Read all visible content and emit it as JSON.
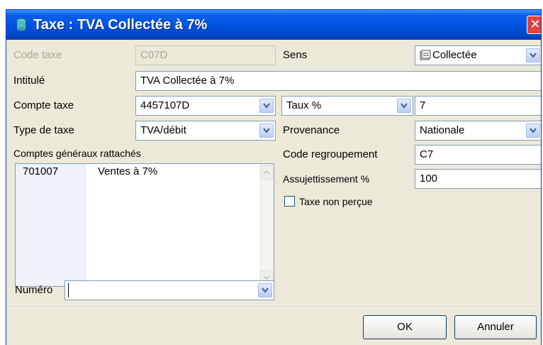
{
  "window": {
    "title": "Taxe : TVA Collectée à 7%"
  },
  "fields": {
    "code_taxe": {
      "label": "Code taxe",
      "value": "C07D"
    },
    "sens": {
      "label": "Sens",
      "value": "Collectée"
    },
    "intitule": {
      "label": "Intitulé",
      "value": "TVA Collectée à 7%"
    },
    "compte_taxe": {
      "label": "Compte taxe",
      "value": "4457107D"
    },
    "taux": {
      "label": "Taux %",
      "value": "7"
    },
    "type_taxe": {
      "label": "Type de taxe",
      "value": "TVA/débit"
    },
    "provenance": {
      "label": "Provenance",
      "value": "Nationale"
    },
    "code_regroupement": {
      "label": "Code regroupement",
      "value": "C7"
    },
    "assujettissement": {
      "label": "Assujettissement %",
      "value": "100"
    },
    "taxe_non_percue": {
      "label": "Taxe non perçue",
      "checked": false
    },
    "numero": {
      "label": "Numéro",
      "value": ""
    }
  },
  "comptes": {
    "label": "Comptes généraux rattachés",
    "rows": [
      {
        "numero": "701007",
        "intitule": "Ventes à 7%"
      }
    ]
  },
  "buttons": {
    "ok": "OK",
    "annuler": "Annuler"
  },
  "icons": {
    "title": "app-icon",
    "close": "close-icon",
    "dropdown": "chevron-down-icon",
    "sens": "calendar-icon"
  }
}
